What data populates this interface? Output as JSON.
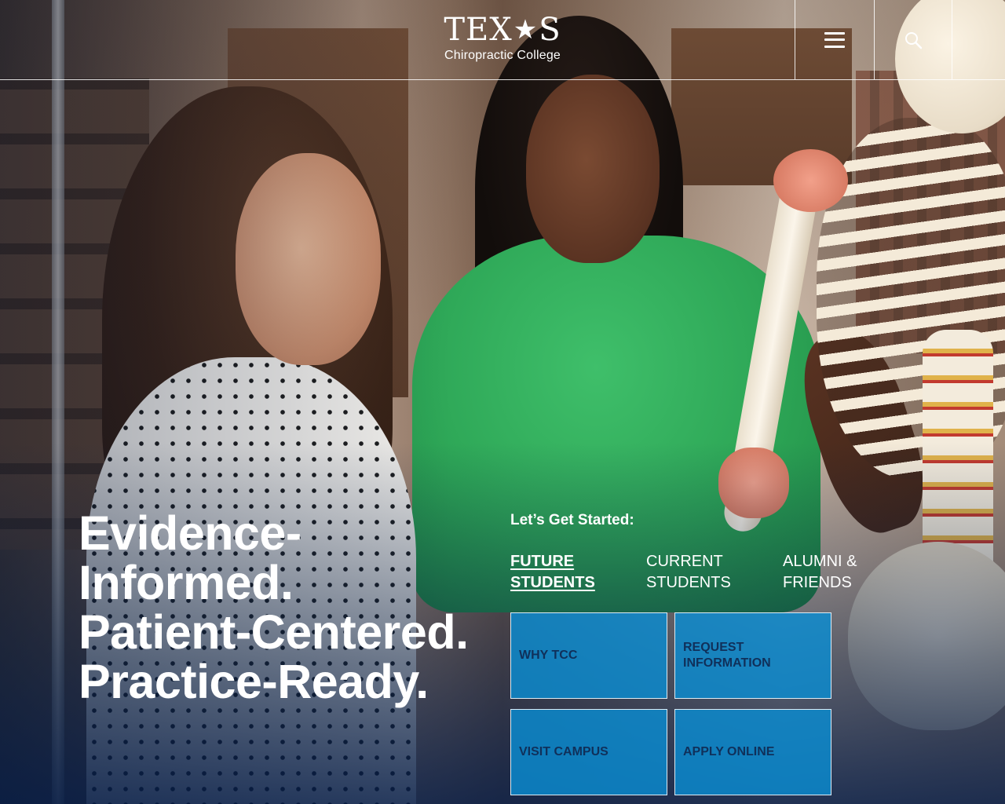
{
  "header": {
    "logo_word_left": "TEX",
    "logo_star": "★",
    "logo_word_right": "S",
    "logo_subtitle": "Chiropractic College",
    "menu_icon": "hamburger-menu-icon",
    "search_icon": "search-icon"
  },
  "hero": {
    "headline_lines": [
      "Evidence-",
      "Informed.",
      "Patient-Centered.",
      "Practice-Ready."
    ]
  },
  "get_started": {
    "title": "Let’s Get Started:",
    "tabs": [
      {
        "line1": "FUTURE",
        "line2": "STUDENTS",
        "active": true
      },
      {
        "line1": "CURRENT",
        "line2": "STUDENTS",
        "active": false
      },
      {
        "line1": "ALUMNI &",
        "line2": "FRIENDS",
        "active": false
      }
    ],
    "tiles": [
      {
        "label": "WHY TCC"
      },
      {
        "label": "REQUEST INFORMATION"
      },
      {
        "label": "VISIT CAMPUS"
      },
      {
        "label": "APPLY ONLINE"
      }
    ]
  },
  "colors": {
    "tile_bg": "#0a8cd2",
    "tile_text": "#10305a",
    "accent_green_shirt": "#2da656"
  }
}
